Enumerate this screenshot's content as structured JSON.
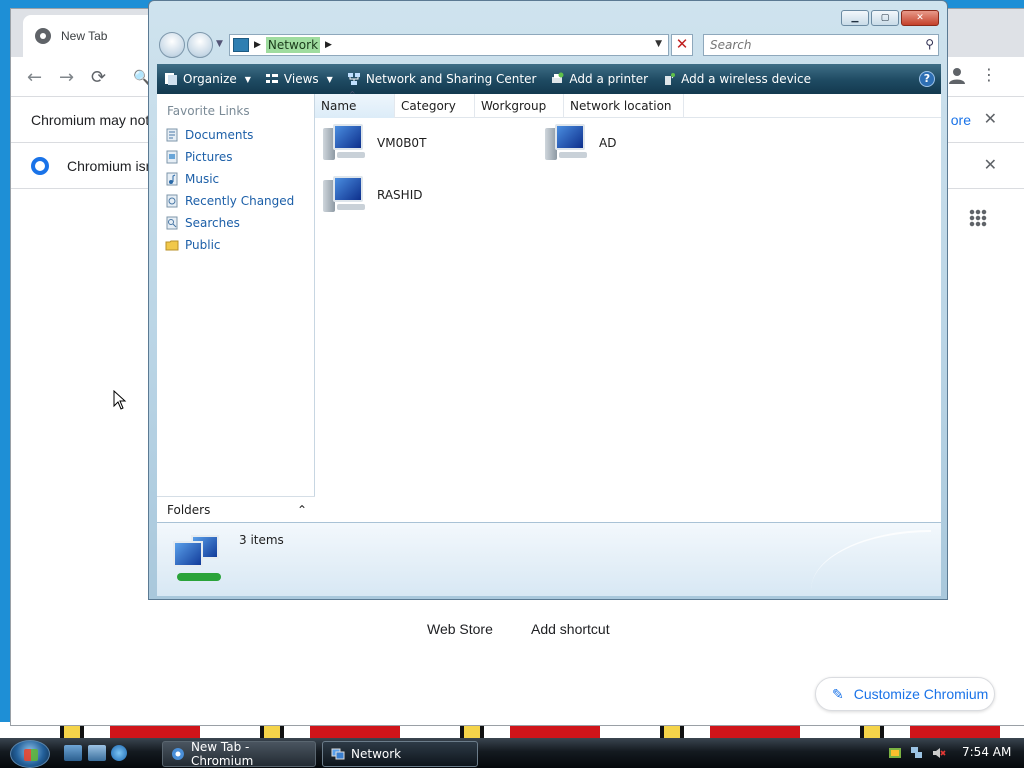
{
  "browser": {
    "tab_title": "New Tab",
    "info1": "Chromium may not f",
    "info1_more": "ore",
    "info2": "Chromium isn't",
    "shortcuts": [
      "Web Store",
      "Add shortcut"
    ],
    "customize": "Customize Chromium"
  },
  "explorer": {
    "address": {
      "crumb": "Network"
    },
    "search_placeholder": "Search",
    "commands": [
      {
        "label": "Organize"
      },
      {
        "label": "Views"
      },
      {
        "label": "Network and Sharing Center"
      },
      {
        "label": "Add a printer"
      },
      {
        "label": "Add a wireless device"
      }
    ],
    "favorite_links_header": "Favorite Links",
    "favorites": [
      "Documents",
      "Pictures",
      "Music",
      "Recently Changed",
      "Searches",
      "Public"
    ],
    "folders_label": "Folders",
    "columns": [
      "Name",
      "Category",
      "Workgroup",
      "Network location"
    ],
    "items": [
      "VM0B0T",
      "AD",
      "RASHID"
    ],
    "status": "3 items"
  },
  "taskbar": {
    "tasks": [
      "New Tab - Chromium",
      "Network"
    ],
    "clock": "7:54 AM"
  },
  "colors": {
    "command_bar": "#1e4a62",
    "link_blue": "#1c5fa8",
    "chrome_accent": "#1a73e8",
    "desktop": "#1e8fd6"
  }
}
